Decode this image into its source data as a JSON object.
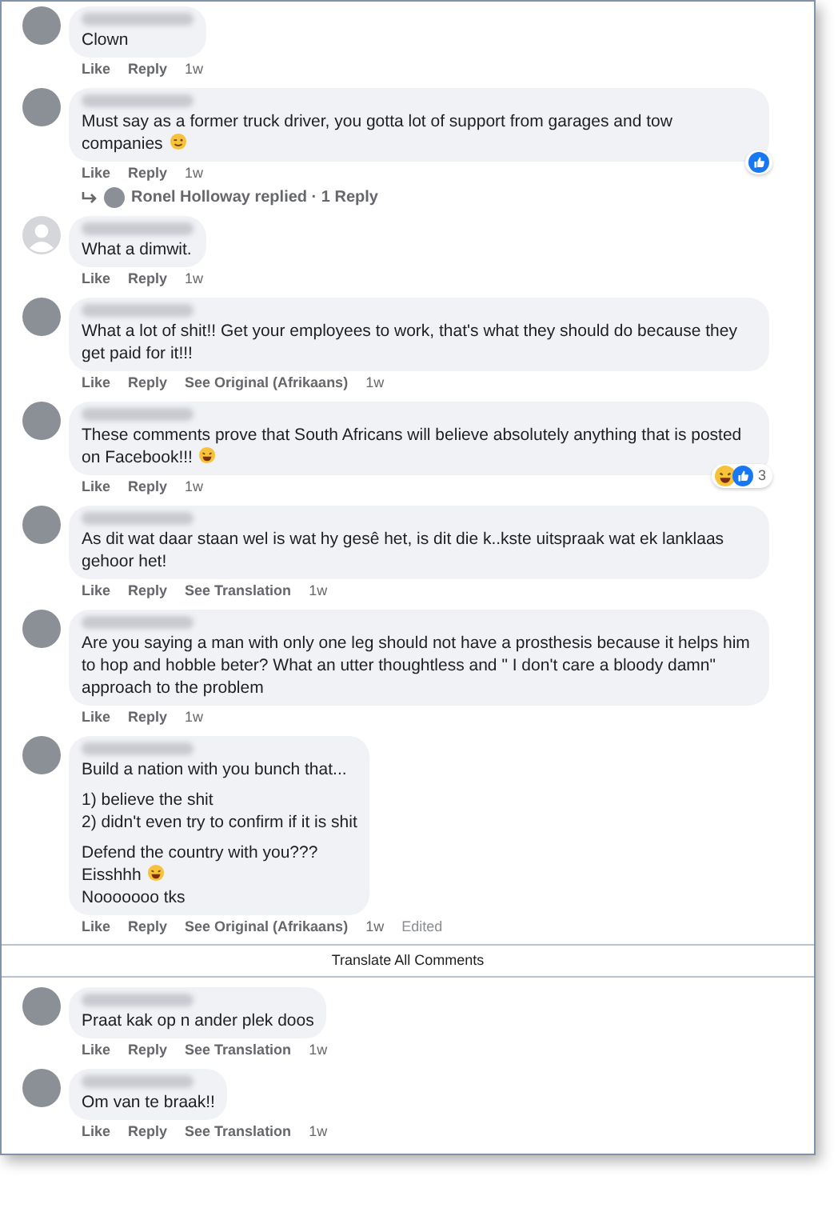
{
  "comments_top": [
    {
      "avatar": {
        "kind": "photo"
      },
      "paragraphs": [
        [
          {
            "text": "Clown"
          }
        ]
      ],
      "actions": [
        "Like",
        "Reply"
      ],
      "time": "1w"
    },
    {
      "avatar": {
        "kind": "photo"
      },
      "paragraphs": [
        [
          {
            "text": "Must say as a former truck driver, you gotta lot of support from garages and tow companies",
            "emoji": {
              "kind": "wink"
            }
          }
        ]
      ],
      "actions": [
        "Like",
        "Reply"
      ],
      "time": "1w",
      "reactions": {
        "items": [
          {
            "kind": "like"
          }
        ]
      },
      "replies": {
        "text": "Ronel Holloway replied · 1 Reply"
      }
    },
    {
      "avatar": {
        "kind": "default"
      },
      "paragraphs": [
        [
          {
            "text": "What a dimwit."
          }
        ]
      ],
      "actions": [
        "Like",
        "Reply"
      ],
      "time": "1w"
    },
    {
      "avatar": {
        "kind": "photo"
      },
      "paragraphs": [
        [
          {
            "text": "What a lot of shit!! Get your employees to work, that's what they should do because they get paid for it!!!"
          }
        ]
      ],
      "actions": [
        "Like",
        "Reply",
        "See Original (Afrikaans)"
      ],
      "time": "1w"
    },
    {
      "avatar": {
        "kind": "photo"
      },
      "paragraphs": [
        [
          {
            "text": "These comments prove that South Africans will believe absolutely anything that is posted on Facebook!!!",
            "emoji": {
              "kind": "laugh"
            }
          }
        ]
      ],
      "actions": [
        "Like",
        "Reply"
      ],
      "time": "1w",
      "reactions": {
        "items": [
          {
            "kind": "haha"
          },
          {
            "kind": "like"
          }
        ],
        "count": "3"
      }
    },
    {
      "avatar": {
        "kind": "photo"
      },
      "paragraphs": [
        [
          {
            "text": "As dit wat daar staan wel is wat hy gesê het, is dit die k..kste uitspraak wat ek lanklaas gehoor het!"
          }
        ]
      ],
      "actions": [
        "Like",
        "Reply",
        "See Translation"
      ],
      "time": "1w"
    },
    {
      "avatar": {
        "kind": "photo"
      },
      "paragraphs": [
        [
          {
            "text": "Are you saying a man with only one leg should not have a prosthesis because it helps him to hop and hobble beter? What an utter thoughtless and \" I don't care a bloody damn\" approach to the problem"
          }
        ]
      ],
      "actions": [
        "Like",
        "Reply"
      ],
      "time": "1w"
    },
    {
      "avatar": {
        "kind": "photo"
      },
      "paragraphs": [
        [
          {
            "text": "Build a nation with you bunch that..."
          }
        ],
        [
          {
            "text": "1) believe the shit"
          },
          {
            "text": "2) didn't even try to confirm if it is shit"
          }
        ],
        [
          {
            "text": "Defend the country with you???"
          },
          {
            "text": "Eisshhh",
            "emoji": {
              "kind": "laugh"
            }
          },
          {
            "text": "Nooooooo tks"
          }
        ]
      ],
      "actions": [
        "Like",
        "Reply",
        "See Original (Afrikaans)"
      ],
      "time": "1w",
      "edited": "Edited"
    }
  ],
  "translate_all": "Translate All Comments",
  "comments_bottom": [
    {
      "avatar": {
        "kind": "photo"
      },
      "paragraphs": [
        [
          {
            "text": "Praat kak op n ander plek doos"
          }
        ]
      ],
      "actions": [
        "Like",
        "Reply",
        "See Translation"
      ],
      "time": "1w"
    },
    {
      "avatar": {
        "kind": "photo"
      },
      "paragraphs": [
        [
          {
            "text": "Om van te braak!!"
          }
        ]
      ],
      "actions": [
        "Like",
        "Reply",
        "See Translation"
      ],
      "time": "1w"
    }
  ]
}
